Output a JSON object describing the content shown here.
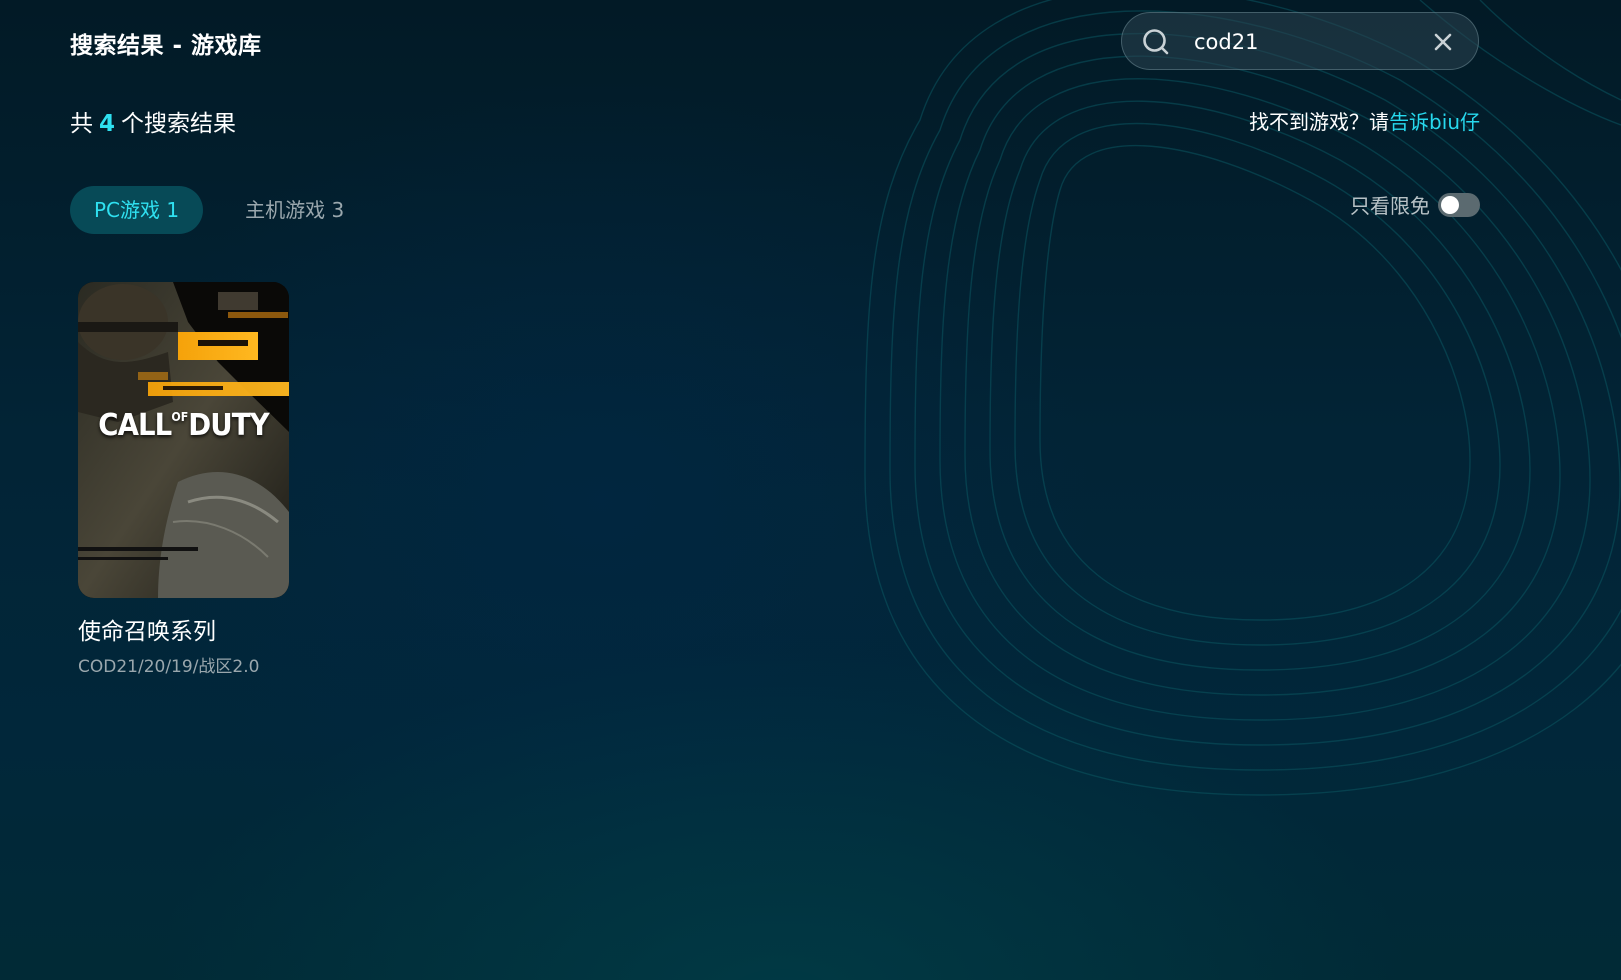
{
  "header": {
    "title": "搜索结果 - 游戏库"
  },
  "search": {
    "value": "cod21",
    "placeholder": "",
    "icon": "search-icon",
    "clear_icon": "close-icon"
  },
  "summary": {
    "prefix": "共",
    "count": "4",
    "suffix": "个搜索结果"
  },
  "feedback": {
    "text": "找不到游戏？请",
    "link": "告诉biu仔"
  },
  "tabs": [
    {
      "label": "PC游戏 1",
      "active": true
    },
    {
      "label": "主机游戏 3",
      "active": false
    }
  ],
  "filter": {
    "label": "只看限免",
    "enabled": false
  },
  "results": [
    {
      "name": "使命召唤系列",
      "subtitle": "COD21/20/19/战区2.0",
      "cover_logo": {
        "part1": "CALL",
        "part2": "OF",
        "part3": "DUTY"
      }
    }
  ],
  "colors": {
    "accent": "#2fe0f0",
    "tab_active_bg": "#074a57",
    "muted_text": "#9aa7ad"
  }
}
